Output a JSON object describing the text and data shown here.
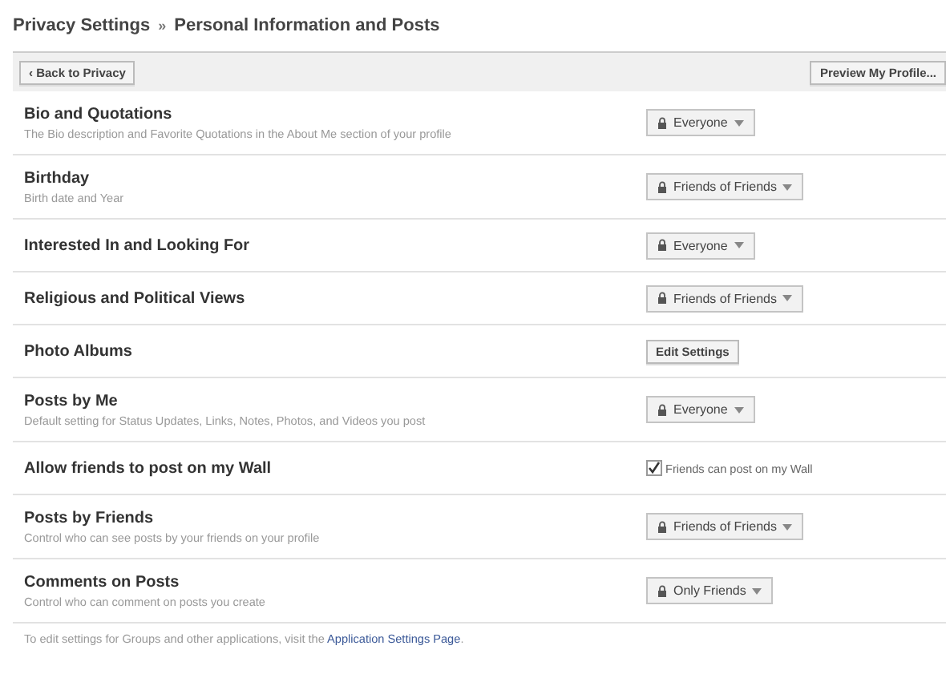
{
  "breadcrumb": {
    "parent": "Privacy Settings",
    "separator": "»",
    "current": "Personal Information and Posts"
  },
  "toolbar": {
    "back_button": "‹ Back to Privacy",
    "preview_button": "Preview My Profile..."
  },
  "settings": [
    {
      "title": "Bio and Quotations",
      "description": "The Bio description and Favorite Quotations in the About Me section of your profile",
      "kind": "dropdown",
      "value": "Everyone"
    },
    {
      "title": "Birthday",
      "description": "Birth date and Year",
      "kind": "dropdown",
      "value": "Friends of Friends"
    },
    {
      "title": "Interested In and Looking For",
      "kind": "dropdown",
      "value": "Everyone"
    },
    {
      "title": "Religious and Political Views",
      "kind": "dropdown",
      "value": "Friends of Friends"
    },
    {
      "title": "Photo Albums",
      "kind": "button",
      "value": "Edit Settings"
    },
    {
      "title": "Posts by Me",
      "description": "Default setting for Status Updates, Links, Notes, Photos, and Videos you post",
      "kind": "dropdown",
      "value": "Everyone"
    },
    {
      "title": "Allow friends to post on my Wall",
      "kind": "checkbox",
      "value": "Friends can post on my Wall",
      "checked": true
    },
    {
      "title": "Posts by Friends",
      "description": "Control who can see posts by your friends on your profile",
      "kind": "dropdown",
      "value": "Friends of Friends"
    },
    {
      "title": "Comments on Posts",
      "description": "Control who can comment on posts you create",
      "kind": "dropdown",
      "value": "Only Friends"
    }
  ],
  "footer": {
    "text": "To edit settings for Groups and other applications, visit the",
    "link": "Application Settings Page",
    "end": "."
  }
}
